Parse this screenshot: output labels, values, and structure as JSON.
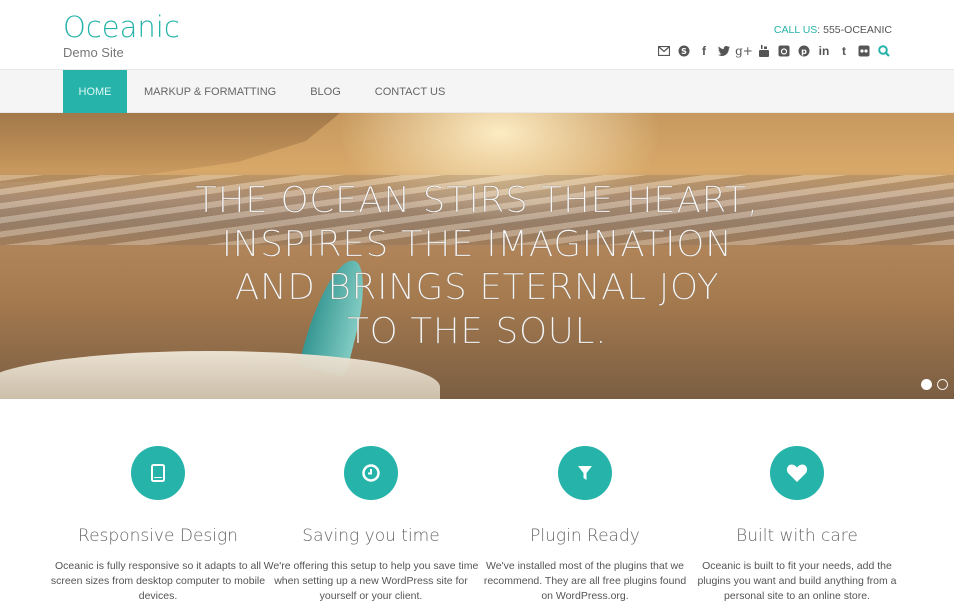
{
  "header": {
    "site_title": "Oceanic",
    "site_description": "Demo Site",
    "call_label": "CALL US",
    "call_number": ": 555-OCEANIC",
    "social_icons": [
      "email-icon",
      "skype-icon",
      "facebook-icon",
      "twitter-icon",
      "google-plus-icon",
      "youtube-icon",
      "instagram-icon",
      "pinterest-icon",
      "linkedin-icon",
      "tumblr-icon",
      "flickr-icon",
      "search-icon"
    ]
  },
  "nav": {
    "items": [
      {
        "label": "HOME",
        "active": true
      },
      {
        "label": "MARKUP & FORMATTING",
        "active": false
      },
      {
        "label": "BLOG",
        "active": false
      },
      {
        "label": "CONTACT US",
        "active": false
      }
    ]
  },
  "hero": {
    "lines": [
      "THE OCEAN STIRS THE HEART,",
      "INSPIRES THE IMAGINATION",
      "AND BRINGS ETERNAL JOY",
      "TO THE SOUL."
    ],
    "slide_count": 2,
    "active_slide": 1
  },
  "features": [
    {
      "icon": "tablet-icon",
      "title": "Responsive Design",
      "text": "Oceanic is fully responsive so it adapts to all screen sizes from desktop computer to mobile devices."
    },
    {
      "icon": "clock-icon",
      "title": "Saving you time",
      "text": "We're offering this setup to help you save time when setting up a new WordPress site for yourself or your client."
    },
    {
      "icon": "filter-icon",
      "title": "Plugin Ready",
      "text": "We've installed most of the plugins that we recommend. They are all free plugins found on WordPress.org."
    },
    {
      "icon": "heart-icon",
      "title": "Built with care",
      "text": "Oceanic is built to fit your needs, add the plugins you want and build anything from a personal site to an online store."
    }
  ],
  "colors": {
    "accent": "#26b3a9",
    "nav_bg": "#f5f5f5",
    "text": "#555555"
  }
}
